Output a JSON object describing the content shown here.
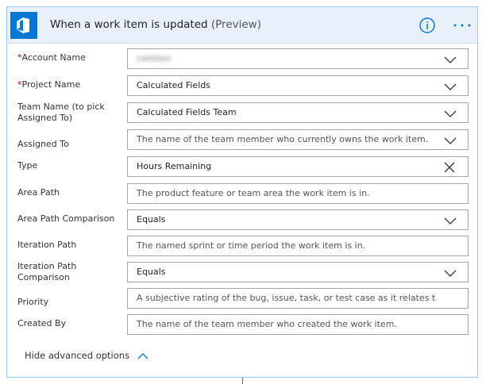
{
  "header": {
    "title": "When a work item is updated",
    "preview": "(Preview)",
    "logo_icon": "azure-devops-logo",
    "info_icon": "info-icon",
    "more_icon": "more-icon",
    "accent_color": "#0078d4"
  },
  "fields": [
    {
      "label": "Account Name",
      "required": "*",
      "value": "contoso",
      "kind": "dropdown",
      "obscured": true
    },
    {
      "label": "Project Name",
      "required": "*",
      "value": "Calculated Fields",
      "kind": "dropdown"
    },
    {
      "label": "Team Name (to pick Assigned To)",
      "value": "Calculated Fields Team",
      "kind": "dropdown"
    },
    {
      "label": "Assigned To",
      "placeholder": "The name of the team member who currently owns the work item.",
      "kind": "dropdown"
    },
    {
      "label": "Type",
      "value": "Hours Remaining",
      "kind": "clearable"
    },
    {
      "label": "Area Path",
      "placeholder": "The product feature or team area the work item is in.",
      "kind": "text"
    },
    {
      "label": "Area Path Comparison",
      "value": "Equals",
      "kind": "dropdown"
    },
    {
      "label": "Iteration Path",
      "placeholder": "The named sprint or time period the work item is in.",
      "kind": "text"
    },
    {
      "label": "Iteration Path Comparison",
      "value": "Equals",
      "kind": "dropdown"
    },
    {
      "label": "Priority",
      "placeholder": "A subjective rating of the bug, issue, task, or test case as it relates to the busin",
      "kind": "text"
    },
    {
      "label": "Created By",
      "placeholder": "The name of the team member who created the work item.",
      "kind": "text"
    }
  ],
  "footer": {
    "advanced_label": "Hide advanced options",
    "advanced_icon": "chevron-up-icon"
  }
}
